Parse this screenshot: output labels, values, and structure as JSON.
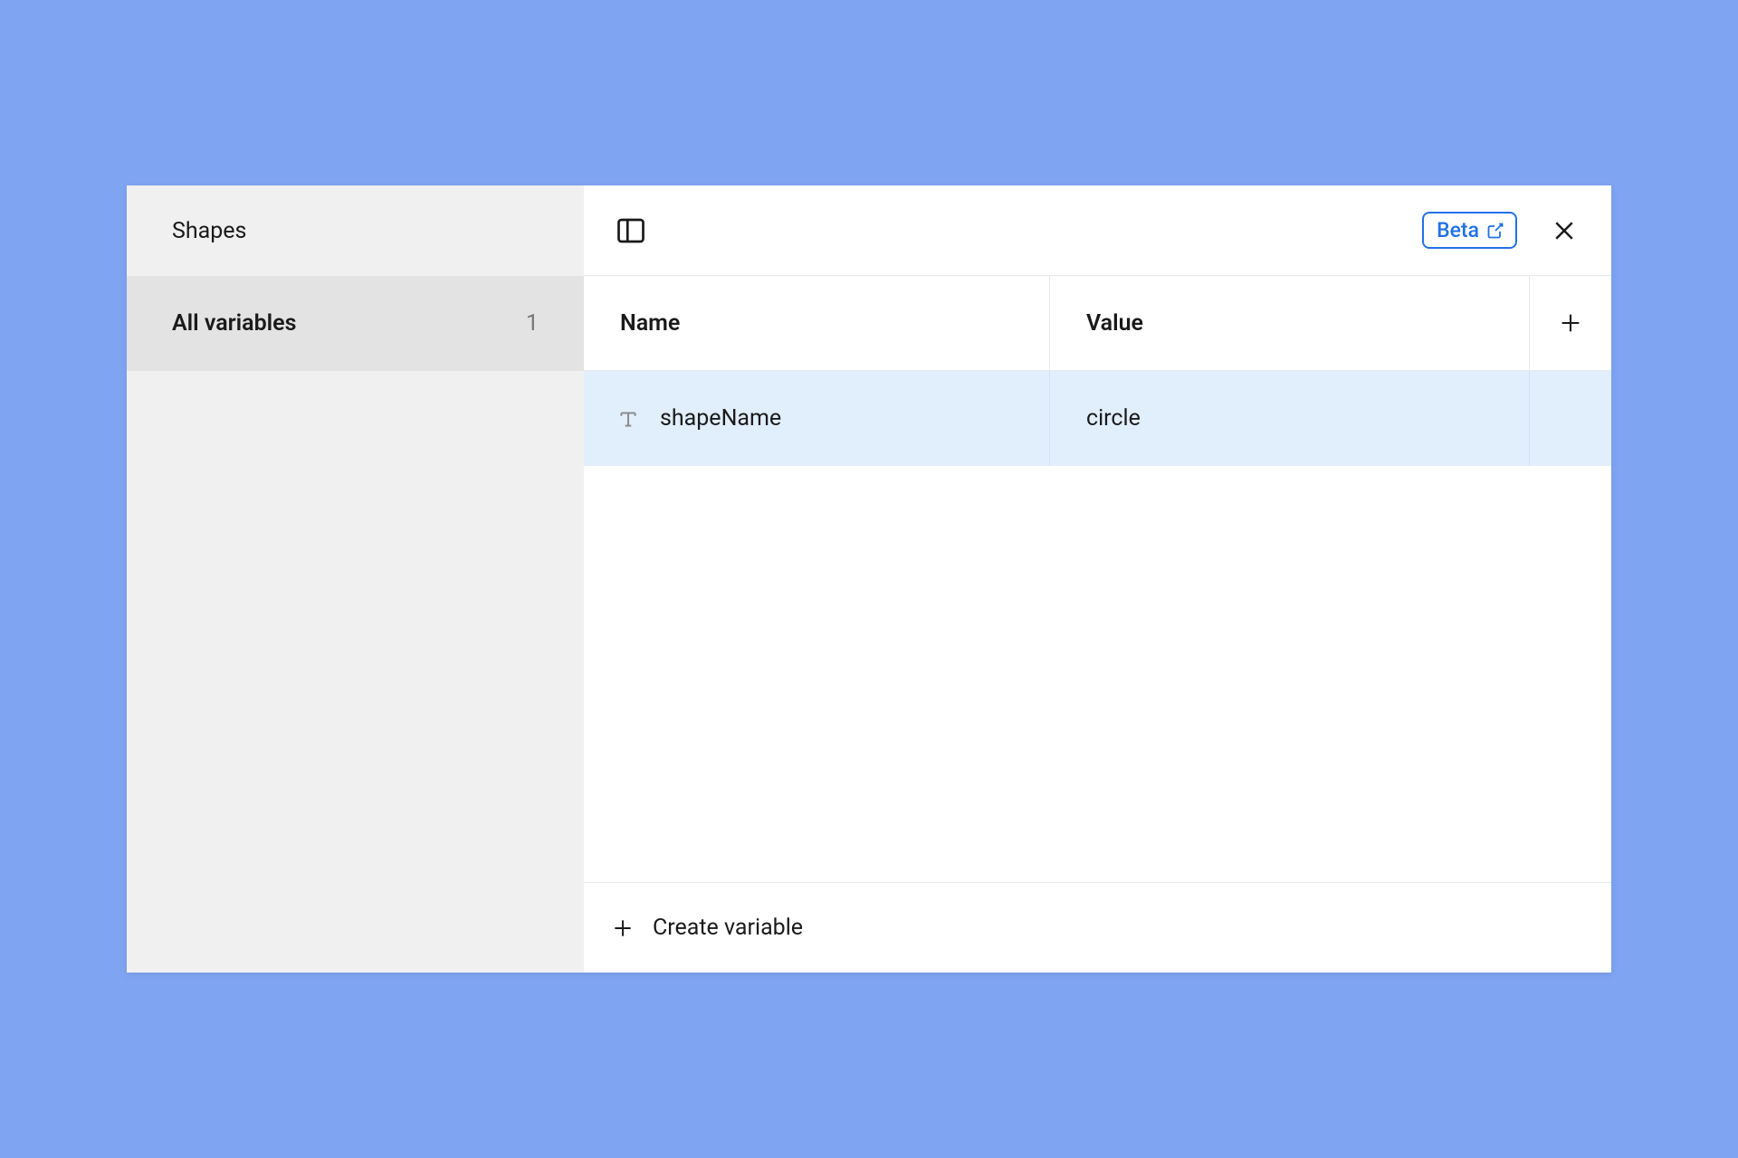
{
  "sidebar": {
    "title": "Shapes",
    "group": {
      "label": "All variables",
      "count": "1"
    }
  },
  "topbar": {
    "beta_label": "Beta"
  },
  "table": {
    "headers": {
      "name": "Name",
      "value": "Value"
    },
    "rows": [
      {
        "type_icon": "text-type-icon",
        "name": "shapeName",
        "value": "circle"
      }
    ]
  },
  "footer": {
    "create_label": "Create variable"
  }
}
